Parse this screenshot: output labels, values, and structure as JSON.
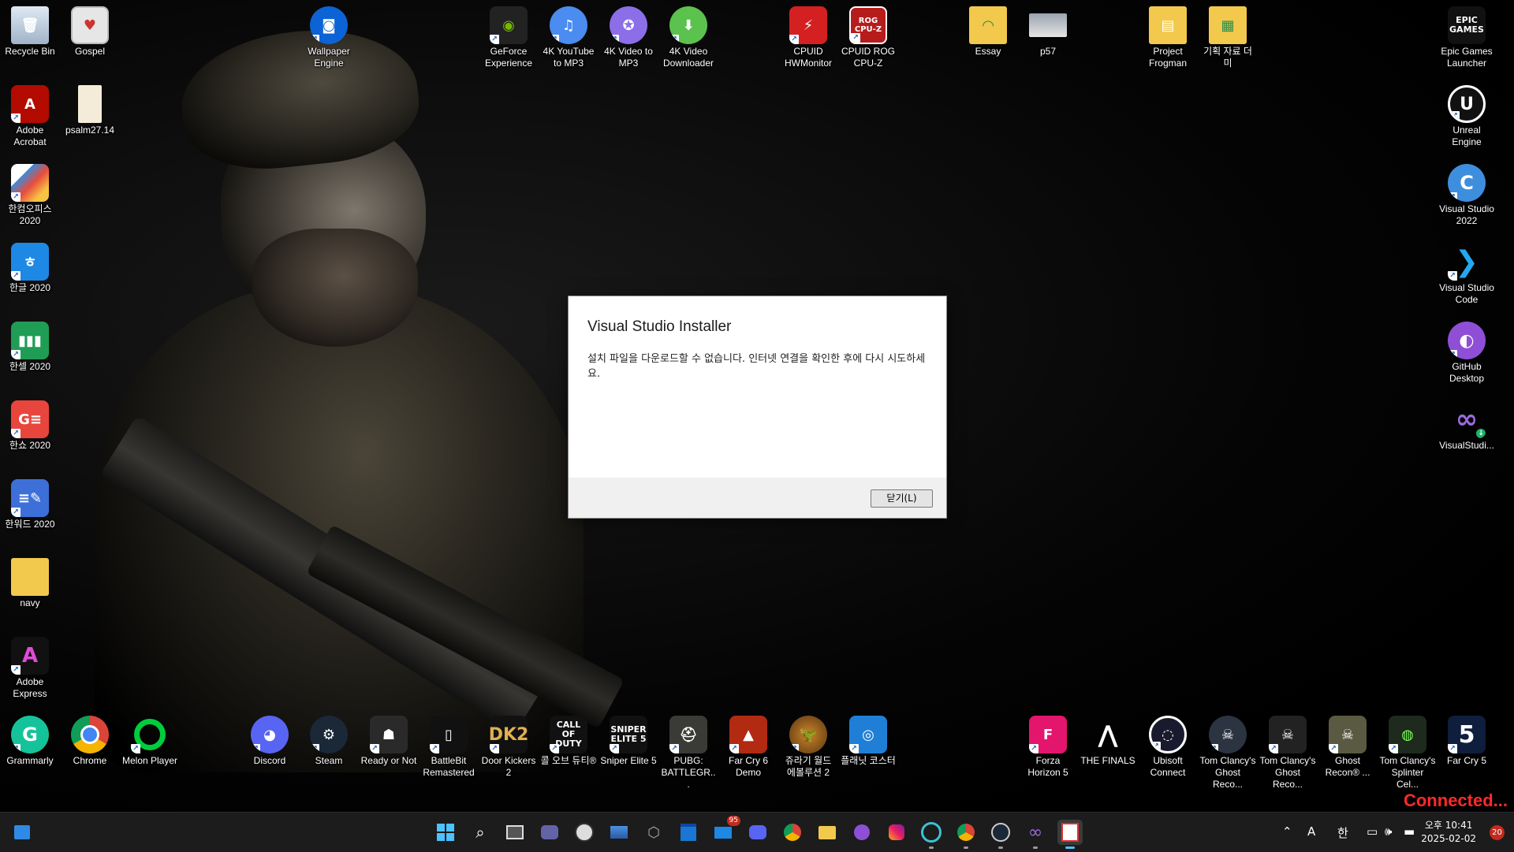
{
  "desktop_icons": {
    "recycle_bin": "Recycle Bin",
    "gospel": "Gospel",
    "wallpaper_engine": "Wallpaper Engine",
    "geforce": "GeForce Experience",
    "yt_mp3": "4K YouTube to MP3",
    "video_mp3": "4K Video to MP3",
    "video_dl": "4K Video Downloader",
    "hwmonitor": "CPUID HWMonitor",
    "cpuz": "CPUID ROG CPU-Z",
    "essay": "Essay",
    "p57": "p57",
    "frogman": "Project Frogman",
    "planning": "기획 자료 더미",
    "epic": "Epic Games Launcher",
    "acrobat": "Adobe Acrobat",
    "psalm": "psalm27.14",
    "unreal": "Unreal Engine",
    "hancom_office": "한컴오피스 2020",
    "vs2022": "Visual Studio 2022",
    "hangul": "한글 2020",
    "vscode": "Visual Studio Code",
    "hancell": "한셀 2020",
    "github": "GitHub Desktop",
    "hanshow": "한쇼 2020",
    "vs_installer": "VisualStudi...",
    "hanword": "한워드 2020",
    "navy": "navy",
    "adobe_express": "Adobe Express",
    "grammarly": "Grammarly",
    "chrome": "Chrome",
    "melon": "Melon Player",
    "discord": "Discord",
    "steam": "Steam",
    "ready_or_not": "Ready or Not",
    "battlebit": "BattleBit Remastered",
    "door_kickers": "Door Kickers 2",
    "cod": "콜 오브 듀티®",
    "sniper": "Sniper Elite 5",
    "pubg": "PUBG: BATTLEGR...",
    "farcry6": "Far Cry 6 Demo",
    "jurassic": "쥬라기 월드 에볼루션 2",
    "planet_coaster": "플래닛 코스터",
    "forza": "Forza Horizon 5",
    "finals": "THE FINALS",
    "ubisoft": "Ubisoft Connect",
    "ghost_recon1": "Tom Clancy's Ghost Reco...",
    "ghost_recon2": "Tom Clancy's Ghost Reco...",
    "ghost_recon3": "Ghost Recon® ...",
    "splinter": "Tom Clancy's Splinter Cel...",
    "farcry5": "Far Cry 5",
    "icon_text_dk2": "DK2",
    "icon_text_cod": "CALL OF DUTY",
    "icon_text_sniper": "SNIPER ELITE 5",
    "icon_text_epic": "EPIC GAMES",
    "icon_text_cpuz": "ROG CPU-Z",
    "icon_text_fc5": "5"
  },
  "dialog": {
    "title": "Visual Studio Installer",
    "message": "설치 파일을 다운로드할 수 없습니다.  인터넷 연결을 확인한 후에 다시 시도하세요.",
    "close_button": "닫기(L)"
  },
  "overlay": {
    "connected": "Connected..."
  },
  "taskbar": {
    "mail_badge": "95",
    "ime_mode": "A",
    "ime_lang": "한",
    "clock_ampm_time": "오후 10:41",
    "date": "2025-02-02",
    "notifications": "20"
  },
  "colors": {
    "taskbar_bg": "#1c1c1c",
    "accent": "#0067c0",
    "connected": "#ff2a2a"
  }
}
